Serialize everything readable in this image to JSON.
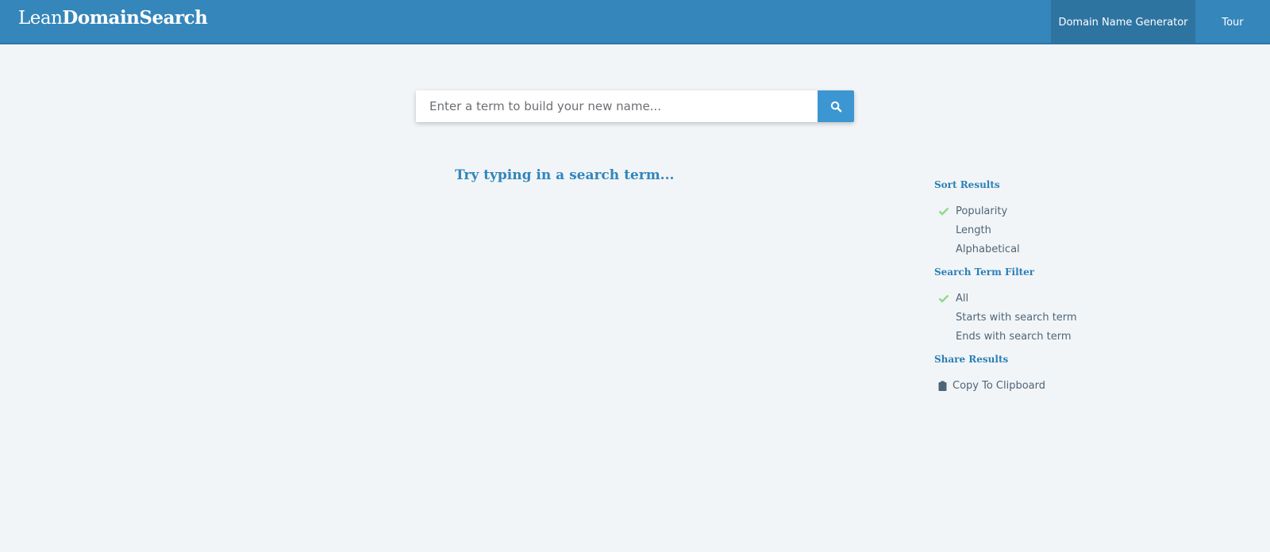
{
  "header": {
    "logo_light": "Lean",
    "logo_bold": "DomainSearch",
    "nav": [
      {
        "label": "Domain Name Generator",
        "active": true
      },
      {
        "label": "Tour",
        "active": false
      }
    ]
  },
  "search": {
    "placeholder": "Enter a term to build your new name...",
    "value": "",
    "button_icon": "search-icon"
  },
  "main": {
    "prompt": "Try typing in a search term..."
  },
  "sidebar": {
    "sort": {
      "title": "Sort Results",
      "options": [
        {
          "label": "Popularity",
          "selected": true
        },
        {
          "label": "Length",
          "selected": false
        },
        {
          "label": "Alphabetical",
          "selected": false
        }
      ]
    },
    "filter": {
      "title": "Search Term Filter",
      "options": [
        {
          "label": "All",
          "selected": true
        },
        {
          "label": "Starts with search term",
          "selected": false
        },
        {
          "label": "Ends with search term",
          "selected": false
        }
      ]
    },
    "share": {
      "title": "Share Results",
      "copy_label": "Copy To Clipboard",
      "copy_icon": "clipboard-icon"
    }
  },
  "colors": {
    "header_bg": "#3586ba",
    "active_nav_bg": "#2e74a1",
    "accent": "#2f86bd",
    "search_button": "#3b96d1",
    "check": "#8fd88a",
    "page_bg": "#f2f5f7"
  }
}
